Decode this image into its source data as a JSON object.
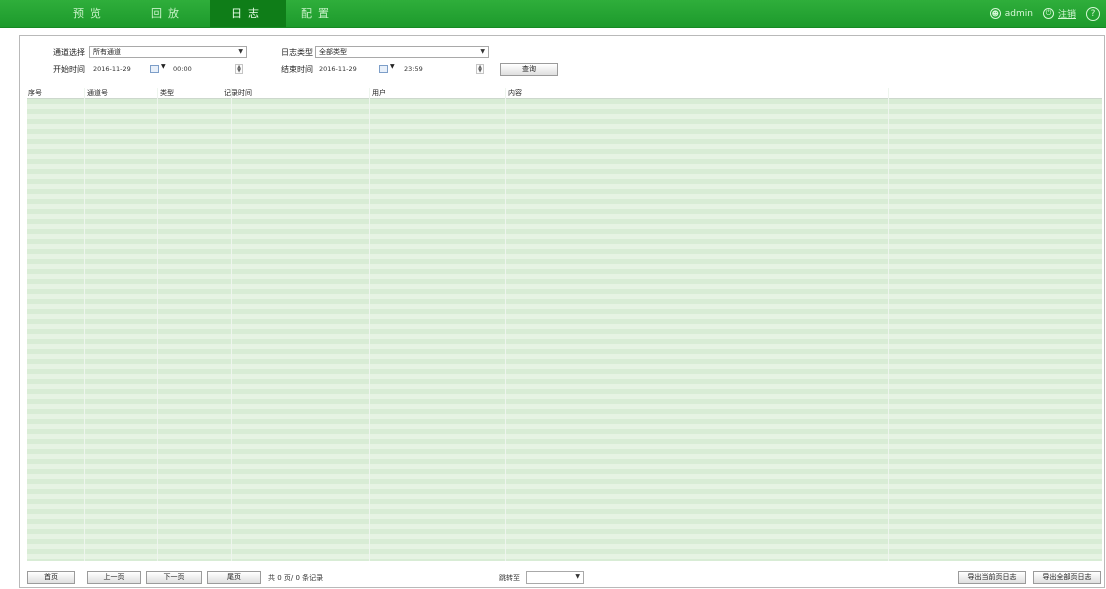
{
  "nav": {
    "tabs": [
      {
        "label": "预览",
        "active": false
      },
      {
        "label": "回放",
        "active": false
      },
      {
        "label": "日志",
        "active": true
      },
      {
        "label": "配置",
        "active": false
      }
    ],
    "user": "admin",
    "logout": "注销",
    "user_icon": "user-circle-icon",
    "logout_icon": "power-icon",
    "help_icon": "help-icon",
    "brand_color": "#22a231",
    "active_tab_color": "#0f7d18"
  },
  "filters": {
    "channel_label": "通道选择",
    "channel_value": "所有通道",
    "log_type_label": "日志类型",
    "log_type_value": "全部类型",
    "start_label": "开始时间",
    "start_date": "2016-11-29",
    "start_time": "00:00",
    "end_label": "结束时间",
    "end_date": "2016-11-29",
    "end_time": "23:59",
    "query_button": "查询"
  },
  "table": {
    "columns": [
      "序号",
      "通道号",
      "类型",
      "记录时间",
      "用户",
      "内容"
    ],
    "rows": [],
    "row_color_a": "#d8ecd5",
    "row_color_b": "#e6f3e3"
  },
  "pager": {
    "first": "首页",
    "prev": "上一页",
    "next": "下一页",
    "last": "尾页",
    "summary": "共 0 页/ 0 条记录",
    "jump_label": "跳转至",
    "jump_value": "",
    "export_current": "导出当前页日志",
    "export_all": "导出全部页日志"
  }
}
